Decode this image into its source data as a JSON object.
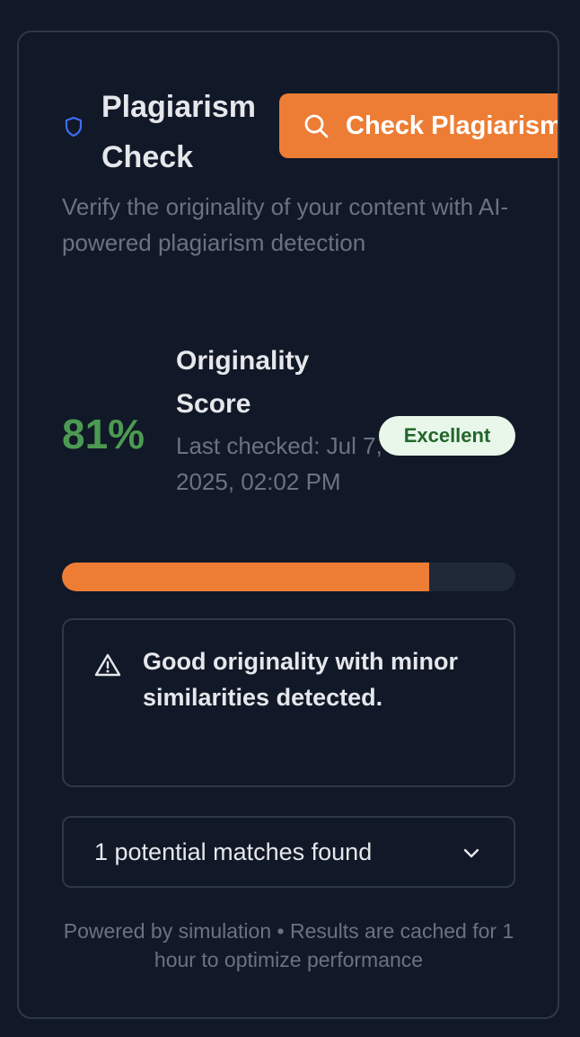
{
  "header": {
    "title": "Plagiarism Check",
    "check_button_label": "Check Plagiarism",
    "description": "Verify the originality of your content with AI-powered plagiarism detection"
  },
  "score": {
    "value": "81%",
    "label": "Originality Score",
    "last_checked": "Last checked: Jul 7, 2025, 02:02 PM",
    "badge": "Excellent",
    "progress_percent": 81
  },
  "alert": {
    "message": "Good originality with minor similarities detected."
  },
  "matches": {
    "summary": "1 potential matches found"
  },
  "footer": {
    "text": "Powered by simulation • Results are cached for 1 hour to optimize performance"
  },
  "colors": {
    "accent": "#ed7d35",
    "score_green": "#4c9a52",
    "shield_blue": "#3b6ef5",
    "badge_bg": "#e8f7ea",
    "badge_text": "#22662b"
  },
  "icons": {
    "header": "shield-icon",
    "button": "search-icon",
    "alert": "warning-triangle-icon",
    "matches": "chevron-down-icon"
  }
}
